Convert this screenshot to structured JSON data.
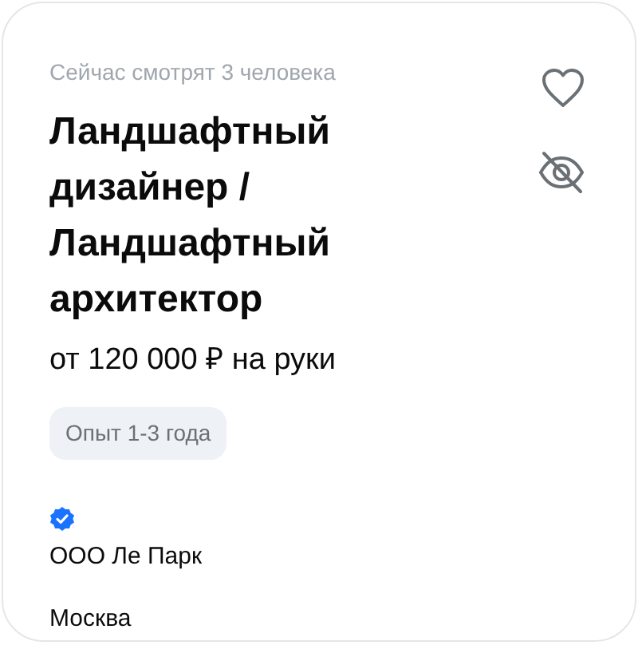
{
  "viewers": "Сейчас смотрят 3 человека",
  "title": "Ландшафтный дизайнер / Ландшафтный архитектор",
  "salary": "от 120 000 ₽ на руки",
  "experience": "Опыт 1-3 года",
  "company": {
    "name": "ООО Ле Парк",
    "verified": true
  },
  "city": "Москва"
}
